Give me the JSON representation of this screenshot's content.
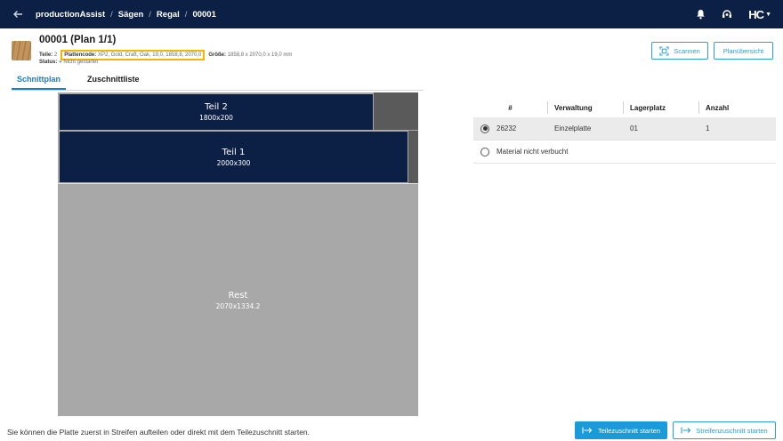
{
  "topbar": {
    "app_name": "productionAssist",
    "crumbs": [
      "Sägen",
      "Regal",
      "00001"
    ],
    "logo": "HC",
    "background": "#0c1f45"
  },
  "header": {
    "title": "00001 (Plan 1/1)",
    "teile_label": "Teile:",
    "teile_value": "2",
    "plattencode_label": "Plattencode:",
    "plattencode_value": "XP2, Gold, Craft, Oak, 19,0, 1858,8, 2070,0",
    "groesse_label": "Größe:",
    "groesse_value": "1858,8 x 2070,0 x 19,0 mm",
    "status_label": "Status:",
    "status_value": "Nicht gestartet",
    "scan_button": "Scannen",
    "overview_button": "Planübersicht"
  },
  "tabs": [
    {
      "label": "Schnittplan",
      "active": true
    },
    {
      "label": "Zuschnittliste",
      "active": false
    }
  ],
  "plan": {
    "pieces": [
      {
        "name": "Teil 2",
        "dims": "1800x200",
        "color": "#0c1f45"
      },
      {
        "name": "Teil 1",
        "dims": "2000x300",
        "color": "#0c1f45"
      },
      {
        "name": "Rest",
        "dims": "2070x1334.2",
        "color": "#a8a8a8"
      }
    ],
    "waste_color": "#5a5a5a"
  },
  "table": {
    "headers": [
      "#",
      "Verwaltung",
      "Lagerplatz",
      "Anzahl"
    ],
    "rows": [
      {
        "id": "26232",
        "verwaltung": "Einzelplatte",
        "lagerplatz": "01",
        "anzahl": "1",
        "selected": true
      }
    ],
    "no_book_option": "Material nicht verbucht"
  },
  "footer": {
    "hint": "Sie können die Platte zuerst in Streifen aufteilen oder direkt mit dem Teilezuschnitt starten.",
    "primary_button": "Teilezuschnitt starten",
    "secondary_button": "Streifenzuschnitt starten",
    "accent": "#1a9ad8"
  }
}
